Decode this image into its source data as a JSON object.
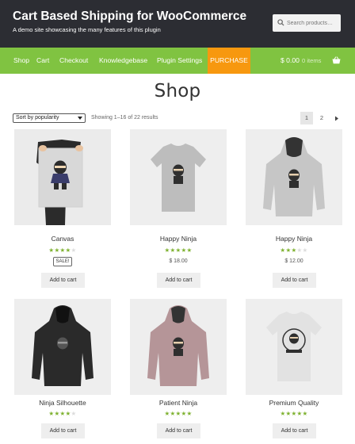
{
  "header": {
    "site_title": "Cart Based Shipping for WooCommerce",
    "site_description": "A demo site showcasing the many features of this plugin",
    "search_placeholder": "Search products…"
  },
  "nav": {
    "items": [
      "Shop",
      "Cart",
      "Checkout",
      "Knowledgebase",
      "Plugin Settings",
      "PURCHASE"
    ],
    "cart_amount": "$ 0.00",
    "cart_items": "0 items"
  },
  "colors": {
    "header_bg": "#2c2d33",
    "nav_bg": "#80c341",
    "purchase_bg": "#f7980f",
    "star_color": "#7fb231"
  },
  "shop": {
    "title": "Shop",
    "sort_selected": "Sort by popularity",
    "result_count": "Showing 1–16 of 22 results",
    "pages": [
      "1",
      "2"
    ],
    "current_page": "1",
    "next_icon": "chevron-right-icon"
  },
  "products": [
    {
      "title": "Canvas",
      "rating": 4,
      "sale_badge": "SALE!",
      "price": "",
      "button": "Add to cart"
    },
    {
      "title": "Happy Ninja",
      "rating": 5,
      "sale_badge": "",
      "price": "$ 18.00",
      "button": "Add to cart"
    },
    {
      "title": "Happy Ninja",
      "rating": 3,
      "sale_badge": "",
      "price": "$ 12.00",
      "button": "Add to cart"
    },
    {
      "title": "Ninja Silhouette",
      "rating": 4,
      "sale_badge": "",
      "price": "",
      "button": "Add to cart"
    },
    {
      "title": "Patient Ninja",
      "rating": 5,
      "sale_badge": "",
      "price": "",
      "button": "Add to cart"
    },
    {
      "title": "Premium Quality",
      "rating": 5,
      "sale_badge": "",
      "price": "",
      "button": "Add to cart"
    }
  ]
}
